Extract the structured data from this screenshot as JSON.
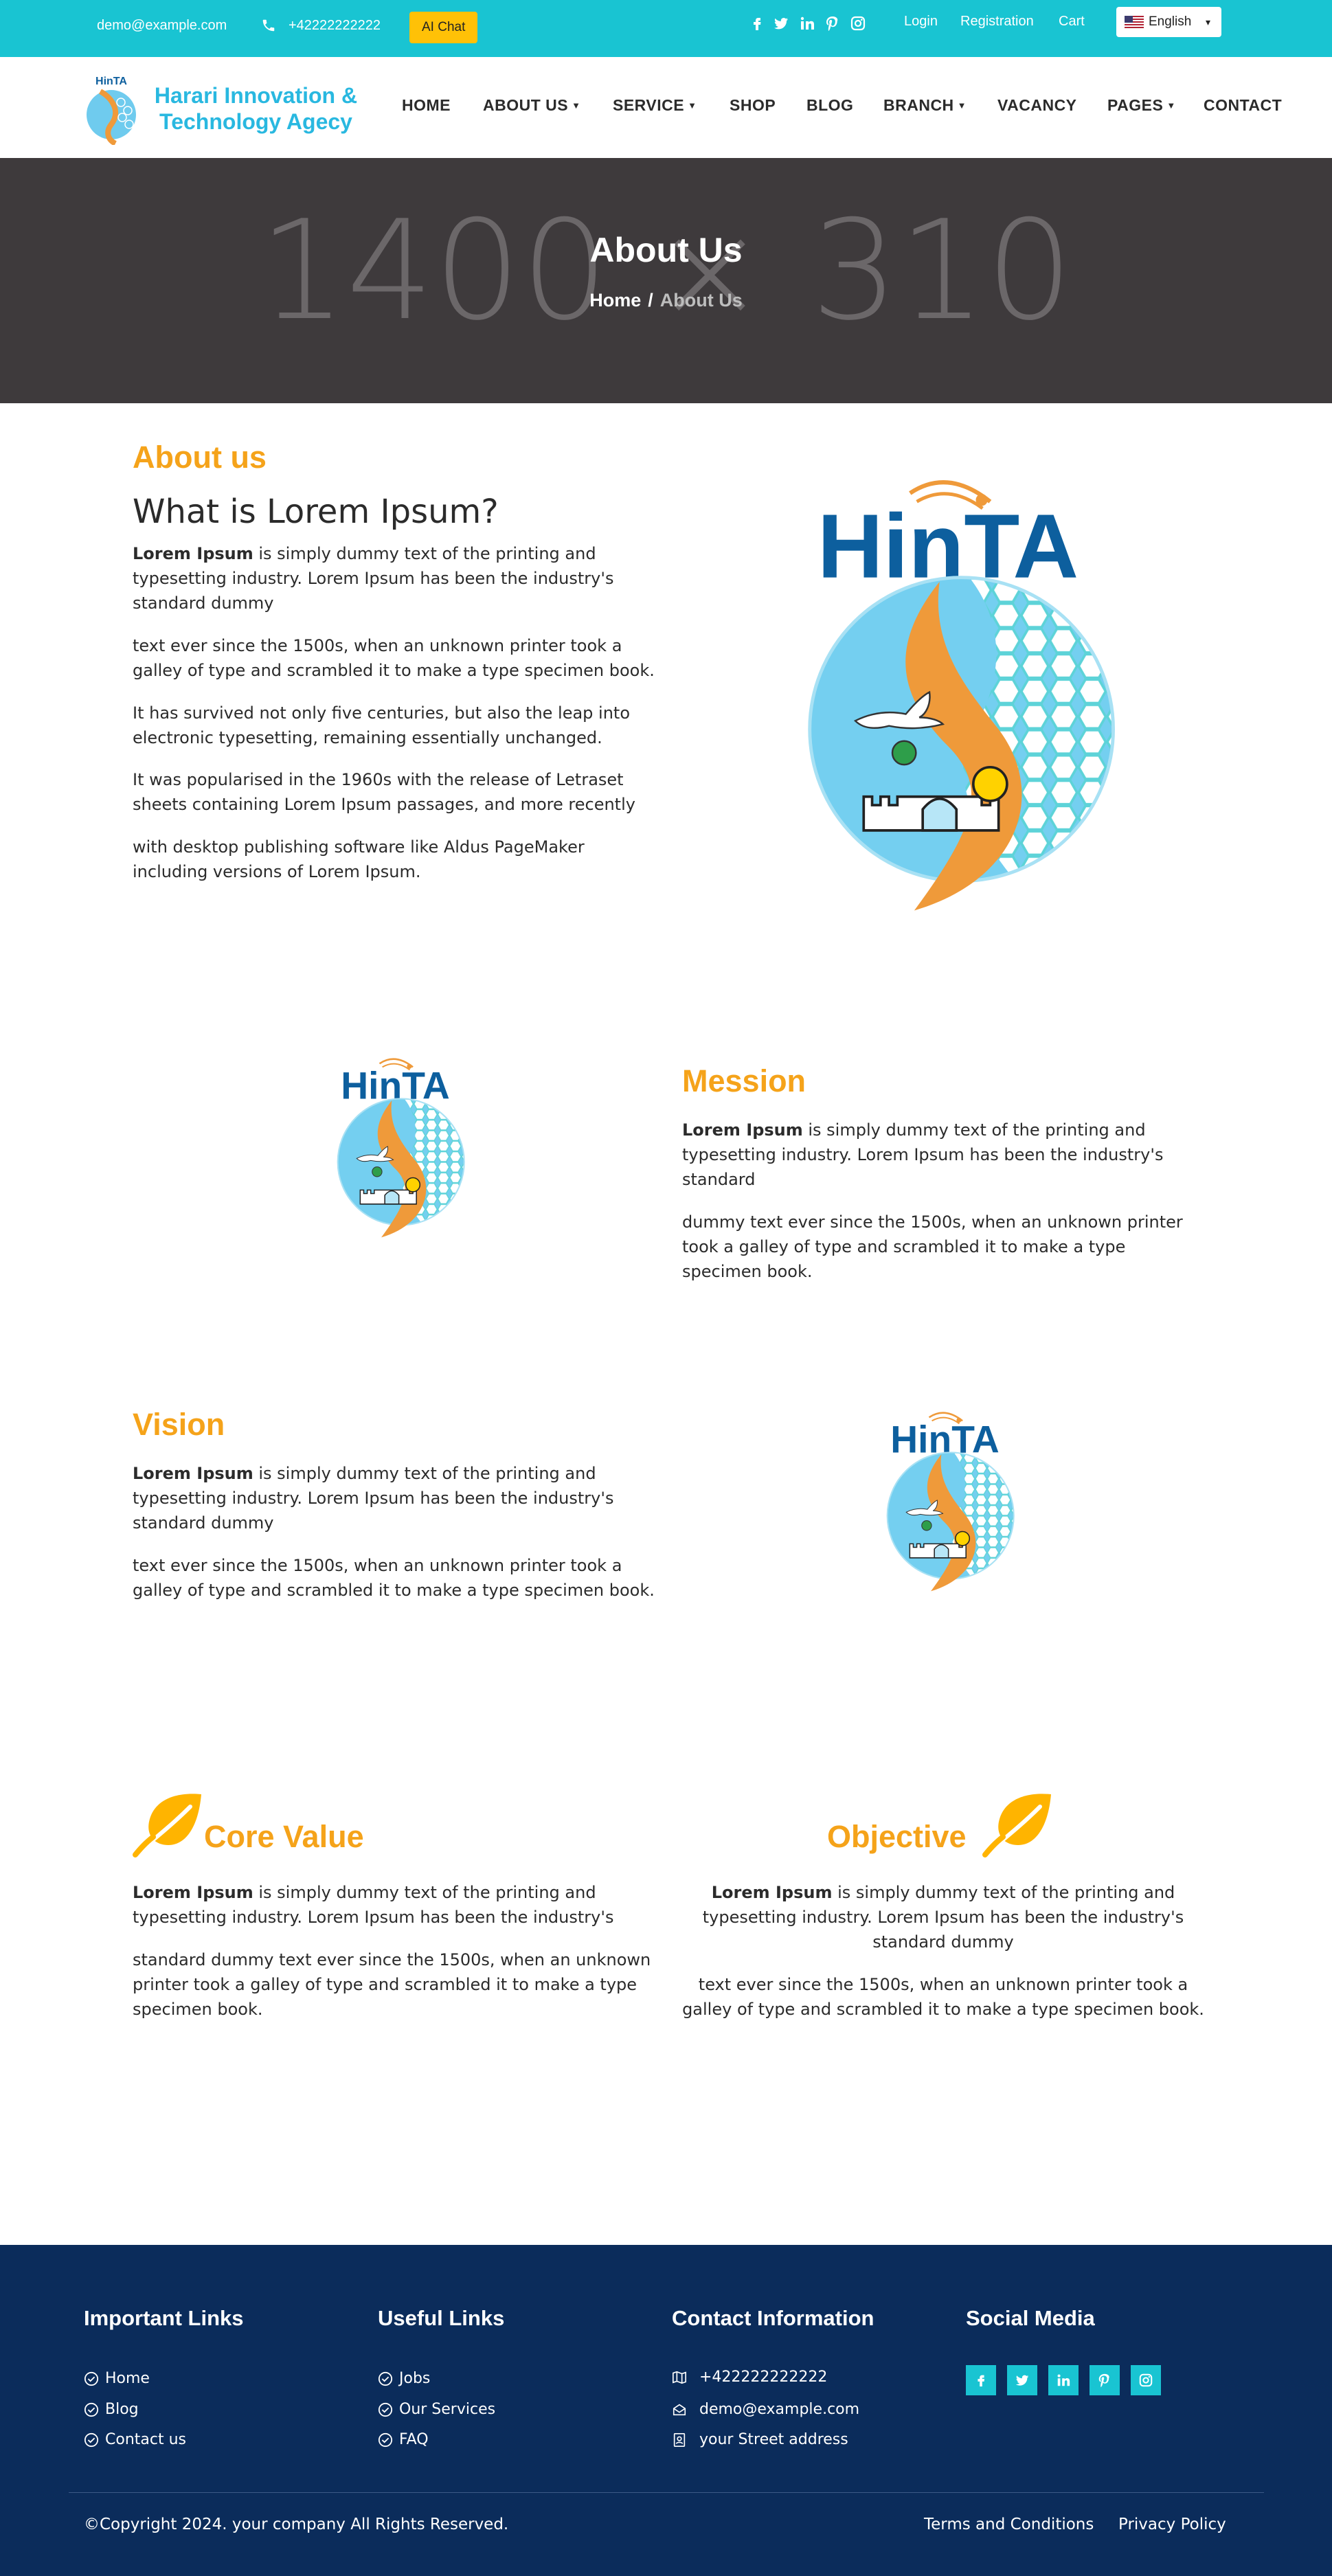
{
  "topbar": {
    "email": "demo@example.com",
    "phone": "+42222222222",
    "ai_chat_label": "AI Chat",
    "social_icons": [
      "facebook-icon",
      "twitter-icon",
      "linkedin-icon",
      "pinterest-icon",
      "instagram-icon"
    ],
    "links": [
      "Login",
      "Registration",
      "Cart"
    ],
    "language": "English"
  },
  "brand": {
    "logo_label": "HinTA",
    "name_line1": "Harari Innovation &",
    "name_line2": "Technology Agecy"
  },
  "nav": {
    "items": [
      "HOME",
      "ABOUT US",
      "SERVICE",
      "SHOP",
      "BLOG",
      "BRANCH",
      "VACANCY",
      "PAGES",
      "CONTACT"
    ]
  },
  "hero": {
    "placeholder": "1400 × 310",
    "title": "About Us",
    "breadcrumb_home": "Home",
    "breadcrumb_sep": "/",
    "breadcrumb_current": "About Us"
  },
  "about": {
    "kicker": "About us",
    "heading": "What is Lorem Ipsum?",
    "lead_bold": "Lorem Ipsum",
    "lead_rest": " is simply dummy text of the printing and typesetting industry. Lorem Ipsum has been the industry's standard dummy",
    "p2": "text ever since the 1500s, when an unknown printer took a galley of type and scrambled it to make a type specimen book.",
    "p3": "It has survived not only five centuries, but also the leap into electronic typesetting, remaining essentially unchanged.",
    "p4": "It was popularised in the 1960s with the release of Letraset sheets containing Lorem Ipsum passages, and more recently",
    "p5": "with desktop publishing software like Aldus PageMaker including versions of Lorem Ipsum."
  },
  "mission": {
    "title": "Mession",
    "lead_bold": "Lorem Ipsum",
    "lead_rest": " is simply dummy text of the printing and typesetting industry. Lorem Ipsum has been the industry's standard",
    "p2": "dummy text ever since the 1500s, when an unknown printer took a galley of type and scrambled it to make a type specimen book."
  },
  "vision": {
    "title": "Vision",
    "lead_bold": "Lorem Ipsum",
    "lead_rest": " is simply dummy text of the printing and typesetting industry. Lorem Ipsum has been the industry's standard dummy",
    "p2": "text ever since the 1500s, when an unknown printer took a galley of type and scrambled it to make a type specimen book."
  },
  "core_value": {
    "title": "Core Value",
    "lead_bold": "Lorem Ipsum",
    "lead_rest": " is simply dummy text of the printing and typesetting industry. Lorem Ipsum has been the industry's",
    "p2": "standard dummy text ever since the 1500s, when an unknown printer took a galley of type and scrambled it to make a type specimen book."
  },
  "objective": {
    "title": "Objective",
    "lead_bold": "Lorem Ipsum",
    "lead_rest": " is simply dummy text of the printing and typesetting industry. Lorem Ipsum has been the industry's standard dummy",
    "p2": "text ever since the 1500s, when an unknown printer took a galley of type and scrambled it to make a type specimen book."
  },
  "footer": {
    "important_links_title": "Important Links",
    "important_links": [
      "Home",
      "Blog",
      "Contact us"
    ],
    "useful_links_title": "Useful Links",
    "useful_links": [
      "Jobs",
      "Our Services",
      "FAQ"
    ],
    "contact_title": "Contact Information",
    "contact_phone": "+422222222222",
    "contact_email": "demo@example.com",
    "contact_address": "your Street address",
    "social_title": "Social Media",
    "social_icons": [
      "facebook-icon",
      "twitter-icon",
      "linkedin-icon",
      "pinterest-icon",
      "instagram-icon"
    ],
    "copyright": "©Copyright 2024. your company All Rights Reserved.",
    "terms": "Terms and Conditions",
    "privacy": "Privacy Policy"
  },
  "colors": {
    "topbar": "#19c4d2",
    "accent_orange": "#f5a31a",
    "hero_bg": "#3e3a3c",
    "footer_bg": "#0b2c5b",
    "chat_button": "#ffc107"
  }
}
